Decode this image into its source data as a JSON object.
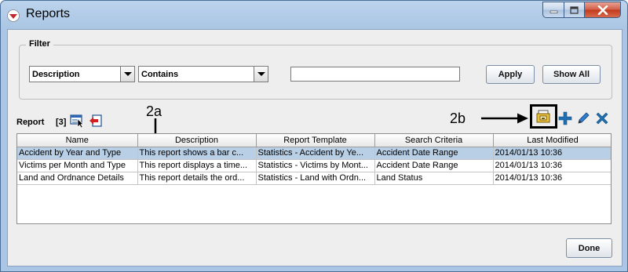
{
  "window": {
    "title": "Reports",
    "icons": {
      "app": "reports-app-icon",
      "minimize": "minimize-icon",
      "maximize": "maximize-icon",
      "close": "close-icon"
    }
  },
  "filter": {
    "legend": "Filter",
    "field_select": {
      "value": "Description"
    },
    "operator_select": {
      "value": "Contains"
    },
    "search_input": {
      "value": ""
    },
    "apply_label": "Apply",
    "show_all_label": "Show All"
  },
  "report": {
    "label": "Report",
    "count": "[3]",
    "left_icons": [
      "select-view-icon",
      "export-icon"
    ],
    "toolbar_icons": [
      "open-report-icon",
      "add-icon",
      "edit-pencil-icon",
      "delete-icon"
    ],
    "annotations": {
      "a": "2a",
      "b": "2b"
    }
  },
  "table": {
    "columns": [
      "Name",
      "Description",
      "Report Template",
      "Search Criteria",
      "Last Modified"
    ],
    "rows": [
      [
        "Accident by Year and Type",
        "This report shows a bar c...",
        "Statistics - Accident by Ye...",
        "Accident Date Range",
        "2014/01/13 10:36"
      ],
      [
        "Victims per Month and Type",
        "This report displays a time...",
        "Statistics - Victims by Mont...",
        "Accident Date Range",
        "2014/01/13 10:36"
      ],
      [
        "Land and Ordnance Details",
        "This report details the ord...",
        "Statistics - Land with Ordn...",
        "Land Status",
        "2014/01/13 10:36"
      ]
    ],
    "selected_row": 0
  },
  "footer": {
    "done_label": "Done"
  },
  "colors": {
    "selection": "#b8cfe5",
    "add_icon": "#1f6fb0",
    "delete_icon": "#1f6fb0",
    "highlight_box": "#000000"
  }
}
